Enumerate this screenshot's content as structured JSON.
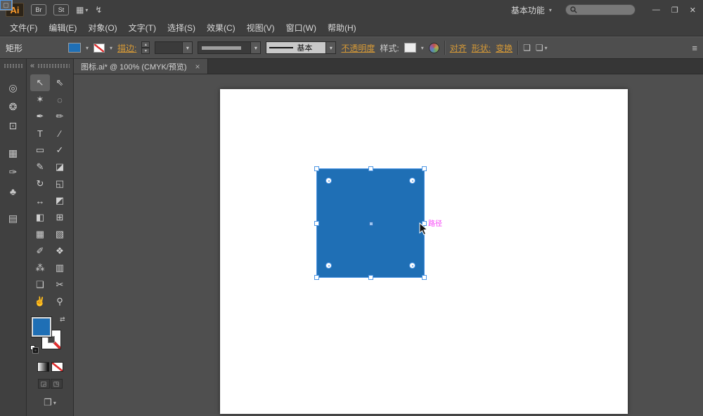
{
  "titlebar": {
    "logo": "Ai",
    "bridge_label": "Br",
    "stock_label": "St",
    "workspace_label": "基本功能",
    "search_value": ""
  },
  "icons": {
    "dropdown": "▾",
    "up": "▴",
    "down": "▾",
    "layout": "▦",
    "services": "↯",
    "collapse": "«",
    "swap": "⇄",
    "minimize": "—",
    "restore": "❐",
    "close": "✕",
    "tab_close": "×",
    "isolate": "❑",
    "select_similar": "❏",
    "panel_menu": "≡",
    "screen_mode": "❐"
  },
  "menubar": {
    "items": [
      {
        "name": "menu-file",
        "label": "文件(F)"
      },
      {
        "name": "menu-edit",
        "label": "编辑(E)"
      },
      {
        "name": "menu-object",
        "label": "对象(O)"
      },
      {
        "name": "menu-type",
        "label": "文字(T)"
      },
      {
        "name": "menu-select",
        "label": "选择(S)"
      },
      {
        "name": "menu-effect",
        "label": "效果(C)"
      },
      {
        "name": "menu-view",
        "label": "视图(V)"
      },
      {
        "name": "menu-window",
        "label": "窗口(W)"
      },
      {
        "name": "menu-help",
        "label": "帮助(H)"
      }
    ]
  },
  "controlbar": {
    "context_label": "矩形",
    "stroke_label": "描边:",
    "stroke_weight_value": "",
    "brush_definition": "基本",
    "opacity_label": "不透明度",
    "style_label": "样式:",
    "align_label": "对齐",
    "shape_label": "形状:",
    "transform_label": "变换"
  },
  "tabbar": {
    "document_title": "图标.ai* @ 100% (CMYK/预览)"
  },
  "dock": {
    "icons": [
      {
        "name": "color-panel-icon",
        "glyph": "◎"
      },
      {
        "name": "appearance-panel-icon",
        "glyph": "❂"
      },
      {
        "name": "export-panel-icon",
        "glyph": "⊡"
      },
      {
        "name": "swatches-panel-icon",
        "glyph": "▦"
      },
      {
        "name": "brushes-panel-icon",
        "glyph": "✑"
      },
      {
        "name": "symbols-panel-icon",
        "glyph": "♣"
      },
      {
        "name": "layers-panel-icon",
        "glyph": "▤"
      }
    ]
  },
  "toolbar": {
    "tools": [
      {
        "name": "selection-tool",
        "glyph": "↖",
        "cls": "tool selected"
      },
      {
        "name": "direct-selection-tool",
        "glyph": "⇖",
        "cls": "tool"
      },
      {
        "name": "magic-wand-tool",
        "glyph": "✶",
        "cls": "tool"
      },
      {
        "name": "lasso-tool",
        "glyph": "◌",
        "cls": "tool"
      },
      {
        "name": "pen-tool",
        "glyph": "✒",
        "cls": "tool"
      },
      {
        "name": "curvature-tool",
        "glyph": "✏",
        "cls": "tool"
      },
      {
        "name": "type-tool",
        "glyph": "T",
        "cls": "tool"
      },
      {
        "name": "line-segment-tool",
        "glyph": "∕",
        "cls": "tool"
      },
      {
        "name": "rectangle-tool",
        "glyph": "▭",
        "cls": "tool"
      },
      {
        "name": "paintbrush-tool",
        "glyph": "✓",
        "cls": "tool"
      },
      {
        "name": "pencil-tool",
        "glyph": "✎",
        "cls": "tool"
      },
      {
        "name": "eraser-tool",
        "glyph": "◪",
        "cls": "tool"
      },
      {
        "name": "rotate-tool",
        "glyph": "↻",
        "cls": "tool"
      },
      {
        "name": "scale-tool",
        "glyph": "◱",
        "cls": "tool"
      },
      {
        "name": "width-tool",
        "glyph": "↔",
        "cls": "tool"
      },
      {
        "name": "free-transform-tool",
        "glyph": "◩",
        "cls": "tool"
      },
      {
        "name": "shape-builder-tool",
        "glyph": "◧",
        "cls": "tool"
      },
      {
        "name": "perspective-grid-tool",
        "glyph": "⊞",
        "cls": "tool"
      },
      {
        "name": "mesh-tool",
        "glyph": "▦",
        "cls": "tool"
      },
      {
        "name": "gradient-tool",
        "glyph": "▧",
        "cls": "tool"
      },
      {
        "name": "eyedropper-tool",
        "glyph": "✐",
        "cls": "tool"
      },
      {
        "name": "blend-tool",
        "glyph": "❖",
        "cls": "tool"
      },
      {
        "name": "symbol-sprayer-tool",
        "glyph": "⁂",
        "cls": "tool"
      },
      {
        "name": "column-graph-tool",
        "glyph": "▥",
        "cls": "tool"
      },
      {
        "name": "artboard-tool",
        "glyph": "❑",
        "cls": "tool"
      },
      {
        "name": "slice-tool",
        "glyph": "✂",
        "cls": "tool"
      },
      {
        "name": "hand-tool",
        "glyph": "✌",
        "cls": "tool"
      },
      {
        "name": "zoom-tool",
        "glyph": "⚲",
        "cls": "tool"
      }
    ],
    "draw_modes": [
      {
        "name": "draw-normal-mode",
        "glyph": "▢",
        "cls": "dmode sel"
      },
      {
        "name": "draw-behind-mode",
        "glyph": "◲",
        "cls": "dmode"
      },
      {
        "name": "draw-inside-mode",
        "glyph": "◳",
        "cls": "dmode"
      }
    ]
  },
  "canvas": {
    "path_label": "路径"
  },
  "colors": {
    "fill_blue": "#1f6fb5",
    "selection_blue": "#4f97e5",
    "path_label_magenta": "#f640f6",
    "link_orange": "#d79a36",
    "canvas_gray": "#4f4f4f"
  }
}
